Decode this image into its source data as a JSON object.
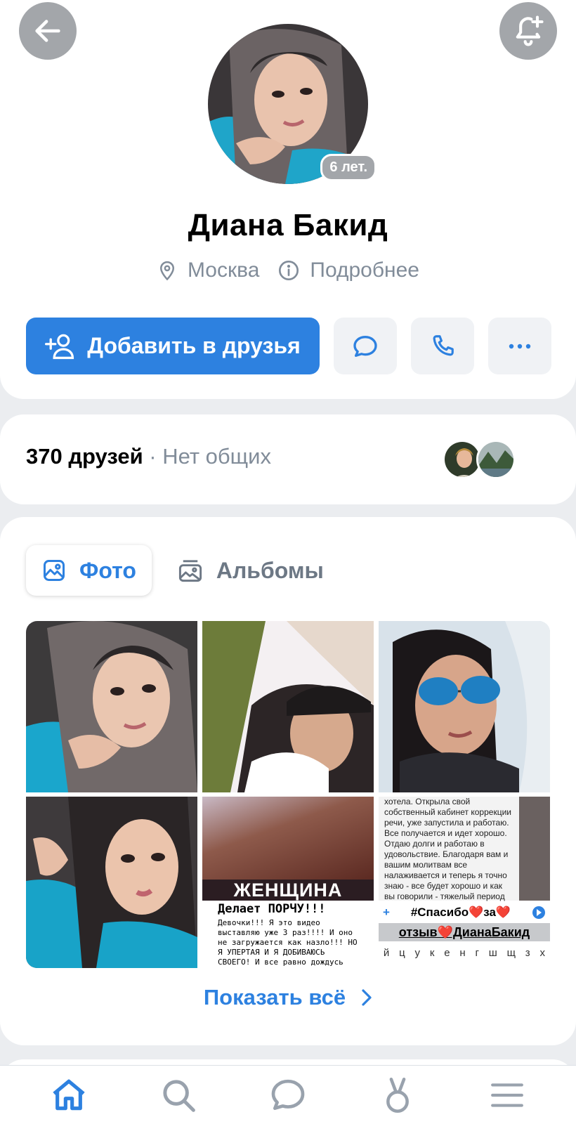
{
  "header": {
    "back_icon": "arrow-left-icon",
    "bell_icon": "bell-plus-icon"
  },
  "profile": {
    "name": "Диана Бакид",
    "age_badge": "6 лет.",
    "city": "Москва",
    "more_label": "Подробнее"
  },
  "actions": {
    "add_friend_label": "Добавить в друзья",
    "message_icon": "message-icon",
    "call_icon": "phone-icon",
    "more_icon": "more-horizontal-icon"
  },
  "friends": {
    "count_label": "370 друзей",
    "mutual_label": " · Нет общих"
  },
  "photos": {
    "tab_photos": "Фото",
    "tab_albums": "Альбомы",
    "tile5_band": "ЖЕНЩИНА",
    "tile5_heading": "Делает ПОРЧУ!!!",
    "tile5_text": "Девочки!!! Я это видео выставляю уже 3 раз!!!! И оно не загружается как назло!!! НО Я УПЕРТАЯ И Я ДОБИВАЮСЬ СВОЕГО! И все равно дождусь пока оно",
    "tile6_text": "хотела. Открыла свой собственный кабинет коррекции речи, уже запустила и работаю. Все получается и идет хорошо. Отдаю долги и работаю в удовольствие. Благодаря вам и вашим молитвам все налаживается и теперь я точно знаю - все будет хорошо и как вы говорили - тяжелый период",
    "tile6_input": "#Спасибо❤️за❤️",
    "tile6_tag": "отзыв❤️ДианаБакид",
    "tile6_keys": [
      "й",
      "ц",
      "у",
      "к",
      "е",
      "н",
      "г",
      "ш",
      "щ",
      "з",
      "х"
    ],
    "show_all_label": "Показать всё"
  },
  "colors": {
    "accent": "#2d81e0",
    "secondary_text": "#818c99",
    "background": "#ebedf0"
  },
  "bottom_nav": [
    "home-icon",
    "search-icon",
    "messages-icon",
    "clips-icon",
    "menu-icon"
  ]
}
